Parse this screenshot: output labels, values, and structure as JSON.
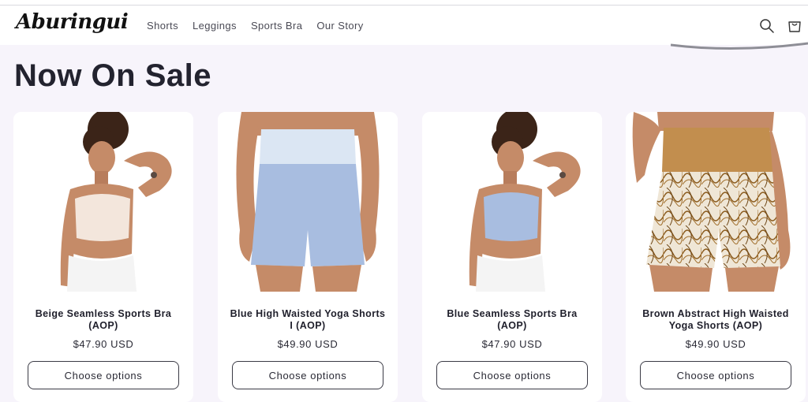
{
  "brand": {
    "logo_text": "Aburingui"
  },
  "nav": {
    "items": [
      "Shorts",
      "Leggings",
      "Sports Bra",
      "Our Story"
    ]
  },
  "header_icons": {
    "search": "search-icon",
    "cart": "cart-icon"
  },
  "page": {
    "title": "Now On Sale"
  },
  "products": [
    {
      "title": "Beige Seamless Sports Bra (AOP)",
      "price": "$47.90 USD",
      "button": "Choose options"
    },
    {
      "title": "Blue High Waisted Yoga Shorts I (AOP)",
      "price": "$49.90 USD",
      "button": "Choose options"
    },
    {
      "title": "Blue Seamless Sports Bra (AOP)",
      "price": "$47.90 USD",
      "button": "Choose options"
    },
    {
      "title": "Brown Abstract High Waisted Yoga Shorts (AOP)",
      "price": "$49.90 USD",
      "button": "Choose options"
    }
  ],
  "colors": {
    "background": "#f7f4fb",
    "text": "#1f1f2b",
    "beige_bra": "#f3e6dc",
    "blue_garment": "#a8bde0",
    "brown_waistband": "#c28e4e",
    "skin": "#c58b68"
  }
}
